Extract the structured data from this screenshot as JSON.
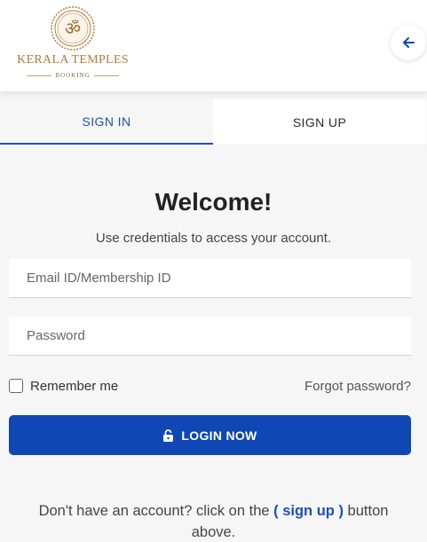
{
  "header": {
    "logo_title": "KERALA TEMPLES",
    "logo_subtitle": "BOOKING",
    "logo_icon": "om-emblem-icon",
    "back_icon": "arrow-left-icon"
  },
  "tabs": [
    {
      "label": "SIGN IN",
      "active": true
    },
    {
      "label": "SIGN UP",
      "active": false
    }
  ],
  "form": {
    "title": "Welcome!",
    "subtitle": "Use credentials to access your account.",
    "email_placeholder": "Email ID/Membership ID",
    "email_value": "",
    "password_placeholder": "Password",
    "password_value": "",
    "remember_label": "Remember me",
    "remember_checked": false,
    "forgot_label": "Forgot password?",
    "login_label": "LOGIN NOW",
    "login_icon": "unlock-icon"
  },
  "footer": {
    "text_before": "Don't have an account? click on the ",
    "link_text": "( sign up )",
    "text_after": " button above."
  },
  "colors": {
    "primary": "#0f47b5",
    "accent_link": "#1d4fb8",
    "logo_gold": "#b07a35",
    "background": "#f6f6f7"
  }
}
